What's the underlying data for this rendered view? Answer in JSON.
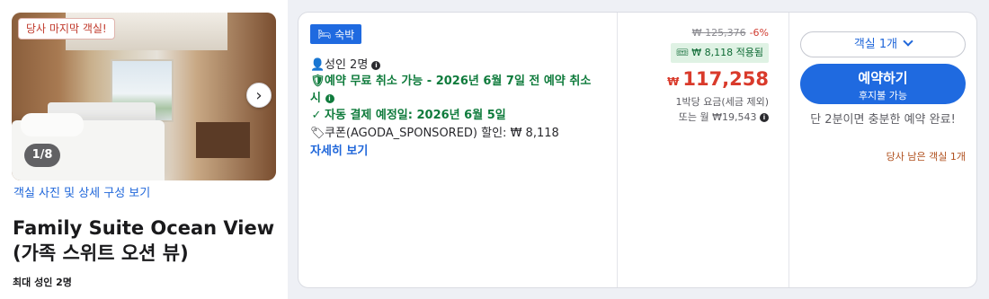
{
  "room": {
    "badge": "당사 마지막 객실!",
    "photo_counter": "1/8",
    "photos_link": "객실 사진 및 상세 구성 보기",
    "title": "Family Suite Ocean View (가족 스위트 오션 뷰)",
    "max_occupancy": "최대 성인 2명"
  },
  "offer": {
    "tag_label": "숙박",
    "guests": "성인 2명",
    "free_cancel": "예약 무료 취소 가능 - 2026년 6월 7일 전 예약 취소 시",
    "auto_payment": "자동 결제 예정일: 2026년 6월 5일",
    "coupon": "쿠폰(AGODA_SPONSORED) 할인: ₩ 8,118",
    "detail_link": "자세히 보기"
  },
  "price": {
    "original": "₩ 125,376",
    "discount_pct": "-6%",
    "coupon_applied": "₩ 8,118 적용됨",
    "currency": "₩",
    "amount": "117,258",
    "per_night": "1박당 요금(세금 제외)",
    "monthly": "또는 월 ₩19,543"
  },
  "action": {
    "room_select": "객실 1개",
    "reserve_main": "예약하기",
    "reserve_sub": "후지불 가능",
    "urgency": "단 2분이면 충분한 예약 완료!",
    "last_room": "당사 남은 객실 1개"
  },
  "colors": {
    "brand_blue": "#1f6ae0",
    "price_red": "#d93a2b",
    "green": "#0f7b3c"
  }
}
